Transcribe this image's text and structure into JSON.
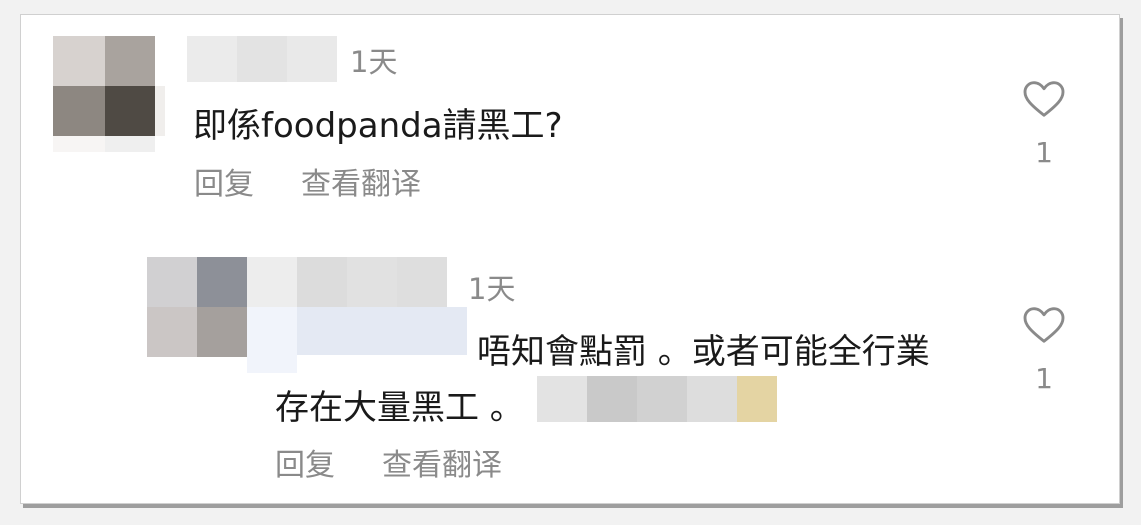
{
  "comments": [
    {
      "timestamp": "1天",
      "text": "即係foodpanda請黑工?",
      "reply_label": "回复",
      "translate_label": "查看翻译",
      "like_count": "1"
    },
    {
      "timestamp": "1天",
      "text_line1": "唔知會點罰 。或者可能全行業",
      "text_line2": "存在大量黑工 。",
      "reply_label": "回复",
      "translate_label": "查看翻译",
      "like_count": "1"
    }
  ],
  "colors": {
    "text_primary": "#1a1a1a",
    "text_secondary": "#8a8a8a",
    "heart_outline": "#8a8a8a"
  },
  "icons": [
    "heart-icon"
  ]
}
